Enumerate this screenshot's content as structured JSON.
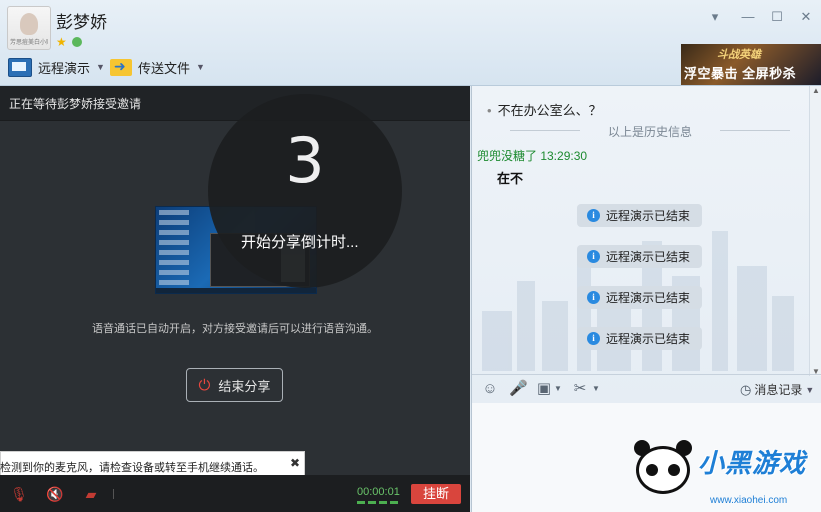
{
  "header": {
    "contact_name": "彭梦娇",
    "avatar_caption": "芳思痘美白小贴士"
  },
  "toolbar": {
    "remote_demo_label": "远程演示",
    "send_file_label": "传送文件"
  },
  "ad": {
    "logo": "斗战英雄",
    "text": "浮空暴击 全屏秒杀"
  },
  "share": {
    "header_text": "正在等待彭梦娇接受邀请",
    "countdown_number": "3",
    "countdown_text": "开始分享倒计时...",
    "voice_notice": "语音通话已自动开启，对方接受邀请后可以进行语音沟通。",
    "end_share_label": "结束分享"
  },
  "call": {
    "mic_warning": "未检测到你的麦克风，请检查设备或转至手机继续通话。",
    "timer": "00:00:01",
    "hangup_label": "挂断"
  },
  "chat": {
    "last_message": "不在办公室么、？",
    "history_divider": "以上是历史信息",
    "sender_line": "兜兜没糖了   13:29:30",
    "message_body": "在不",
    "system_notices": [
      "远程演示已结束",
      "远程演示已结束",
      "远程演示已结束",
      "远程演示已结束"
    ],
    "history_button_label": "消息记录"
  },
  "watermark": {
    "text": "小黑游戏",
    "url": "www.xiaohei.com"
  },
  "colors": {
    "hangup": "#d9453d",
    "sender_green": "#1c8a2f",
    "timer_green": "#6ac46a",
    "info_blue": "#2a8ae0"
  }
}
